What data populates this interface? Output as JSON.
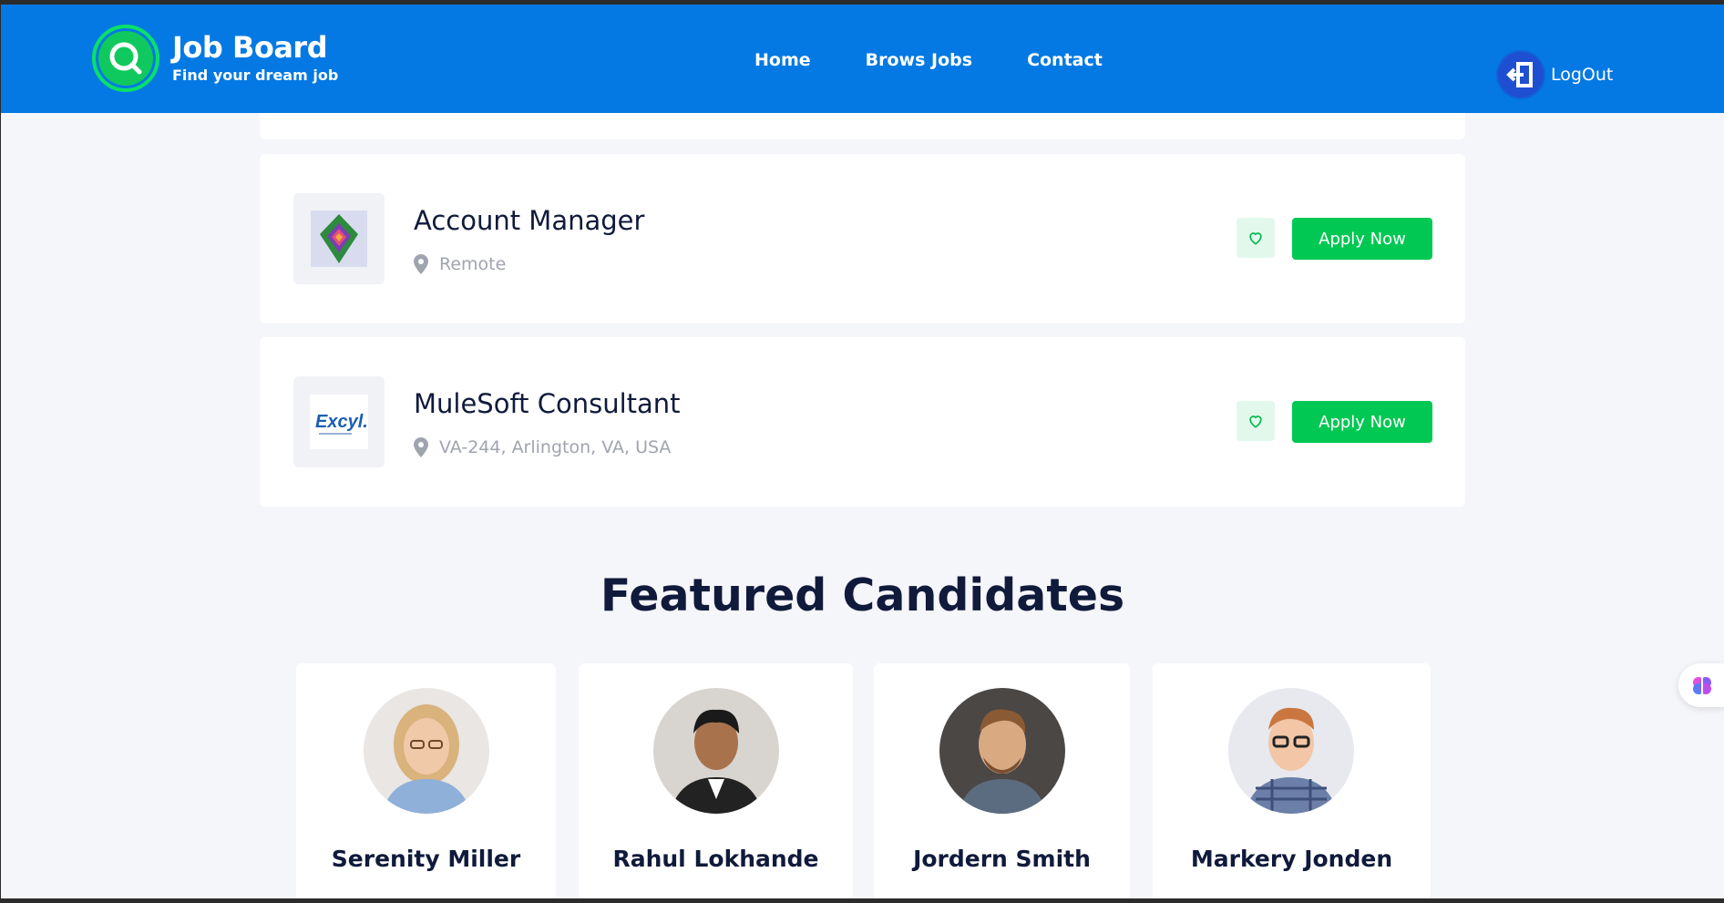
{
  "brand": {
    "title": "Job Board",
    "tagline": "Find your dream job"
  },
  "nav": {
    "links": [
      "Home",
      "Brows Jobs",
      "Contact"
    ],
    "logout_label": "LogOut"
  },
  "jobs": [
    {
      "title": "Account Manager",
      "location": "Remote",
      "apply_label": "Apply Now",
      "logo_icon": "diamond-logo-icon"
    },
    {
      "title": "MuleSoft Consultant",
      "location": "VA-244, Arlington, VA, USA",
      "apply_label": "Apply Now",
      "logo_icon": "excyl-logo",
      "logo_text": "Excyl."
    }
  ],
  "featured": {
    "title": "Featured Candidates",
    "candidates": [
      {
        "name": "Serenity Miller"
      },
      {
        "name": "Rahul Lokhande"
      },
      {
        "name": "Jordern Smith"
      },
      {
        "name": "Markery Jonden"
      }
    ]
  },
  "colors": {
    "nav_bg": "#0479e3",
    "accent_green": "#00c853",
    "title_dark": "#101a3b",
    "page_bg": "#f5f6fa"
  }
}
